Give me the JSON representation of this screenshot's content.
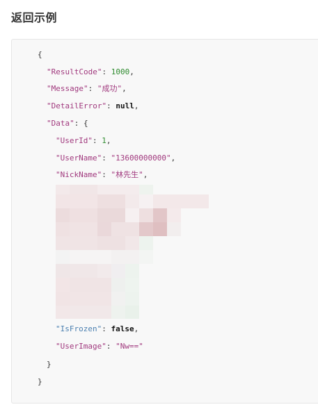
{
  "page": {
    "section_title": "返回示例"
  },
  "code": {
    "open_brace": "{",
    "result_code_key": "\"ResultCode\"",
    "result_code_value": "1000",
    "message_key": "\"Message\"",
    "message_value": "\"成功\"",
    "detail_error_key": "\"DetailError\"",
    "detail_error_value": "null",
    "data_key": "\"Data\"",
    "data_open": "{",
    "user_id_key": "\"UserId\"",
    "user_id_value": "1",
    "user_name_key": "\"UserName\"",
    "user_name_value": "\"13600000000\"",
    "nick_name_key": "\"NickName\"",
    "nick_name_value": "\"林先生\"",
    "is_frozen_key": "\"IsFrozen\"",
    "is_frozen_value": "false",
    "user_image_key": "\"UserImage\"",
    "user_image_value": "\"Nw==\"",
    "data_close": "}",
    "close_brace": "}"
  },
  "colors": {
    "code_background": "#f8f8f8",
    "string_color": "#a0387d",
    "number_color": "#2e8b2e",
    "highlight_key_color": "#4a7fb0"
  }
}
